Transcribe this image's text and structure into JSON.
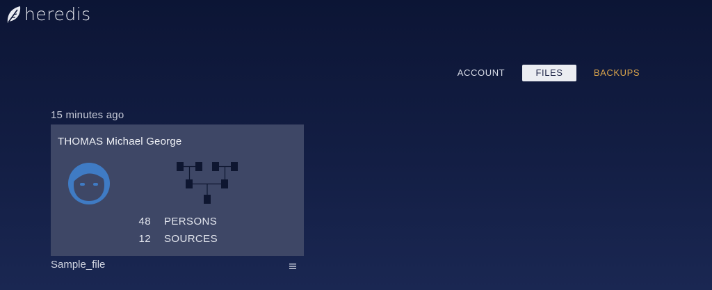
{
  "app": {
    "name": "heredis",
    "logo_icon": "leaf-icon"
  },
  "nav": {
    "tabs": [
      {
        "label": "ACCOUNT",
        "active": false
      },
      {
        "label": "FILES",
        "active": true
      },
      {
        "label": "BACKUPS",
        "active": false
      }
    ]
  },
  "files": [
    {
      "modified": "15 minutes ago",
      "root_person": "THOMAS Michael George",
      "avatar_icon": "person-avatar-icon",
      "tree_icon": "family-tree-icon",
      "stats": [
        {
          "count": "48",
          "label": "PERSONS"
        },
        {
          "count": "12",
          "label": "SOURCES"
        }
      ],
      "name": "Sample_file",
      "menu_icon": "hamburger-menu-icon"
    }
  ],
  "colors": {
    "background": "#0c1535",
    "card": "#3e4766",
    "active_tab_bg": "#ebedf2",
    "backups_accent": "#d7a24b",
    "avatar_blue": "#3f7bc4",
    "tree_dark": "#0e1630"
  }
}
